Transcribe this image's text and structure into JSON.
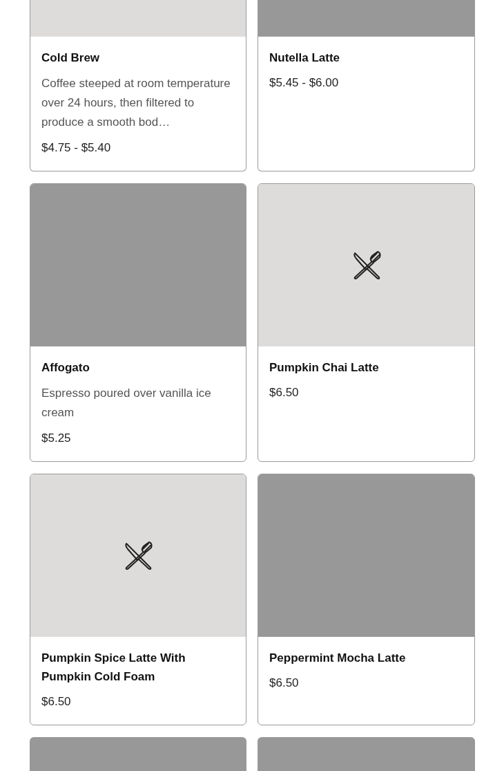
{
  "menu_items": [
    {
      "kind": "placeholder",
      "name": "Cold Brew",
      "description": "Coffee steeped at room temperature over 24 hours, then filtered to produce a smooth bod…",
      "price": "$4.75 - $5.40"
    },
    {
      "kind": "photo",
      "name": "Nutella Latte",
      "price": "$5.45 - $6.00"
    },
    {
      "kind": "photo",
      "name": "Affogato",
      "description": "Espresso poured over vanilla ice cream",
      "price": "$5.25"
    },
    {
      "kind": "placeholder",
      "name": "Pumpkin Chai Latte",
      "price": "$6.50"
    },
    {
      "kind": "placeholder",
      "name": "Pumpkin Spice Latte With Pumpkin Cold Foam",
      "price": "$6.50"
    },
    {
      "kind": "photo",
      "name": "Peppermint Mocha Latte",
      "price": "$6.50"
    },
    {
      "kind": "photo"
    },
    {
      "kind": "photo"
    }
  ]
}
